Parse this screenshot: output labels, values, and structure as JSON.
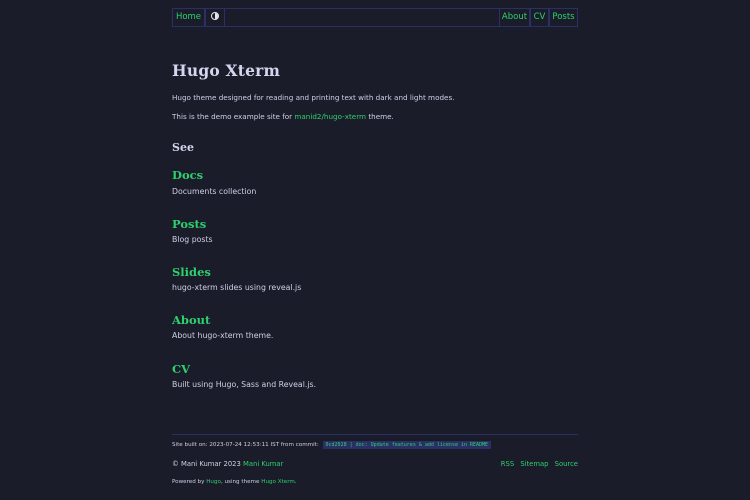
{
  "nav": {
    "home_label": "Home",
    "theme_toggle_icon": "contrast-half-circle-icon",
    "right_items": [
      "About",
      "CV",
      "Posts"
    ]
  },
  "page": {
    "title": "Hugo Xterm",
    "intro": "Hugo theme designed for reading and printing text with dark and light modes.",
    "demo_prefix": "This is the demo example site for ",
    "demo_link": "manid2/hugo-xterm",
    "demo_suffix": " theme."
  },
  "see": {
    "heading": "See",
    "entries": [
      {
        "title": "Docs",
        "description": "Documents collection"
      },
      {
        "title": "Posts",
        "description": "Blog posts"
      },
      {
        "title": "Slides",
        "description": "hugo-xterm slides using reveal.js"
      },
      {
        "title": "About",
        "description": "About hugo-xterm theme."
      },
      {
        "title": "CV",
        "description": "Built using Hugo, Sass and Reveal.js."
      }
    ]
  },
  "footer": {
    "built_on": "Site built on: 2023-07-24 12:53:11 IST from commit:",
    "commit": "0cd2028 | doc: Update features & add license in README",
    "copyright_prefix": "© Mani Kumar 2023 ",
    "copyright_link": "Mani Kumar",
    "links": [
      "RSS",
      "Sitemap",
      "Source"
    ],
    "powered_prefix": "Powered by ",
    "powered_hugo": "Hugo",
    "powered_mid": ", using theme ",
    "powered_theme": "Hugo Xterm",
    "powered_suffix": "."
  },
  "colors": {
    "background": "#1a1c29",
    "accent": "#2ed06e",
    "border": "#2a2f66",
    "text": "#cfd0e6"
  }
}
